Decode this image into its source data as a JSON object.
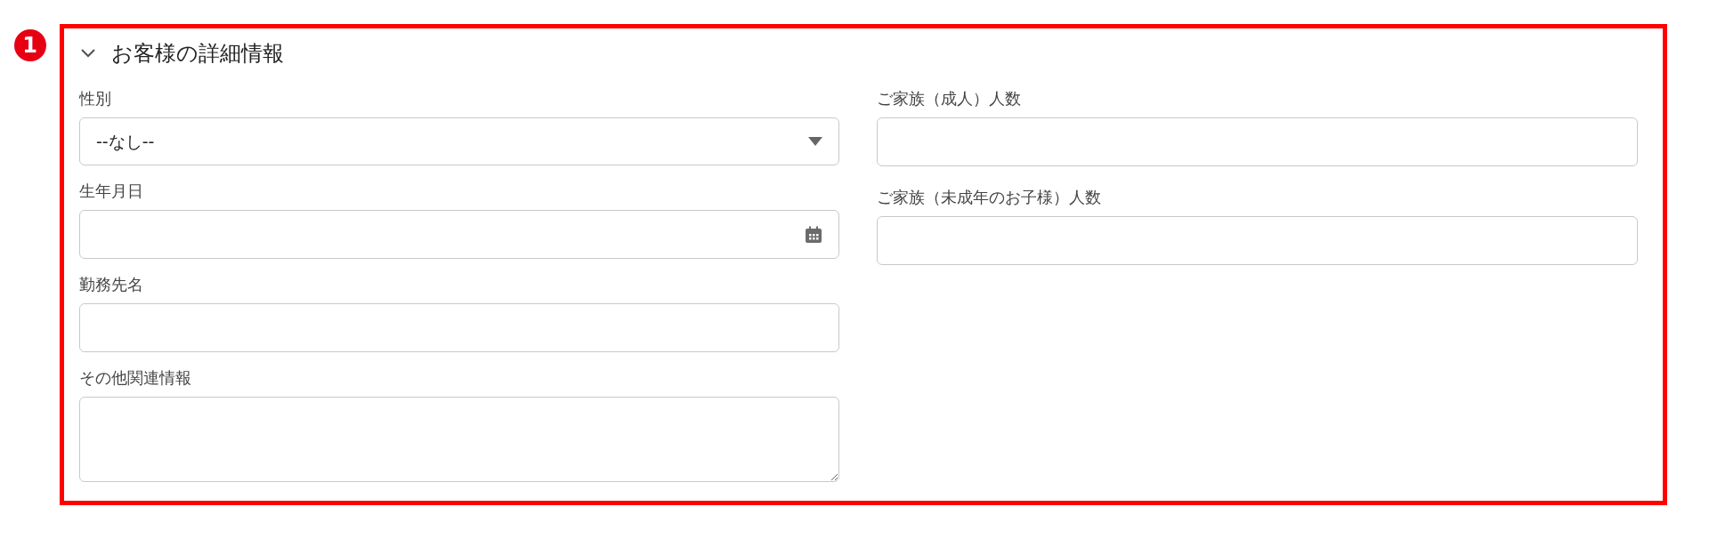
{
  "badge": "1",
  "section": {
    "title": "お客様の詳細情報",
    "expanded": true,
    "left_fields": [
      {
        "kind": "select",
        "label": "性別",
        "value": "--なし--"
      },
      {
        "kind": "date",
        "label": "生年月日"
      },
      {
        "kind": "text",
        "label": "勤務先名"
      },
      {
        "kind": "textarea",
        "label": "その他関連情報"
      }
    ],
    "right_fields": [
      {
        "kind": "text",
        "label": "ご家族（成人）人数"
      },
      {
        "kind": "text",
        "label": "ご家族（未成年のお子様）人数"
      }
    ]
  }
}
